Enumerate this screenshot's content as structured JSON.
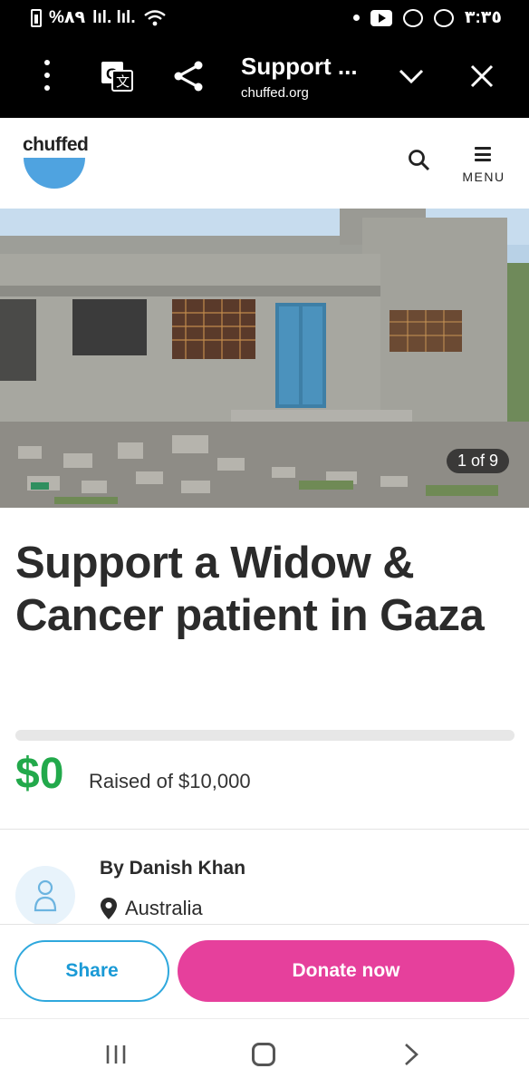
{
  "status_bar": {
    "battery_text": "%٨٩",
    "signal_text": "lıl. lıl.",
    "time": "٣:٣٥"
  },
  "browser": {
    "tab_title": "Support ...",
    "url": "chuffed.org"
  },
  "site": {
    "logo_text": "chuffed",
    "menu_label": "MENU",
    "brand_color": "#4fa3e0"
  },
  "hero": {
    "image_counter": "1 of 9"
  },
  "campaign": {
    "title": "Support a Widow & Cancer patient in Gaza",
    "raised_amount": "$0",
    "raised_of": "Raised of $10,000",
    "progress_fraction": 0,
    "organizer": "By Danish Khan",
    "location": "Australia"
  },
  "actions": {
    "share_label": "Share",
    "donate_label": "Donate now",
    "share_color": "#2fa8dd",
    "donate_color": "#e6409c"
  }
}
